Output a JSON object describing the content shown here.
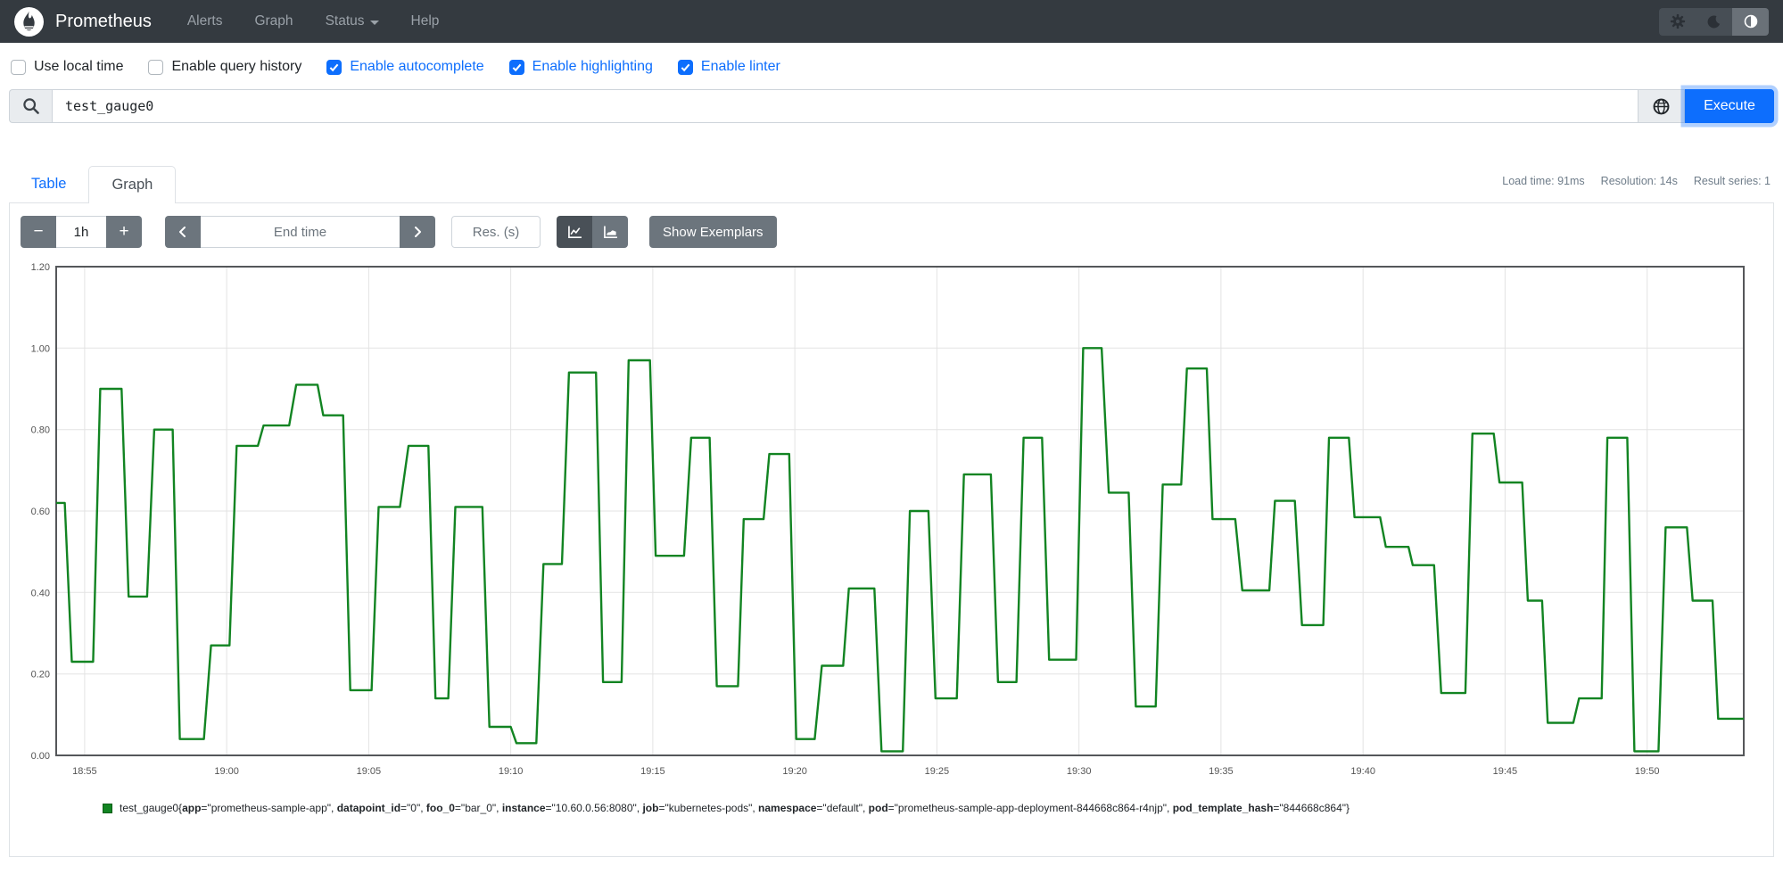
{
  "navbar": {
    "brand": "Prometheus",
    "links": [
      {
        "label": "Alerts"
      },
      {
        "label": "Graph"
      },
      {
        "label": "Status",
        "dropdown": true
      },
      {
        "label": "Help"
      }
    ],
    "theme_buttons": [
      "settings-gear-icon",
      "dark-mode-moon-icon",
      "auto-theme-contrast-icon"
    ],
    "colors": {
      "bar": "#343a40",
      "link": "#9aa1a8",
      "brand": "#ffffff"
    }
  },
  "options": {
    "checkboxes": [
      {
        "label": "Use local time",
        "checked": false
      },
      {
        "label": "Enable query history",
        "checked": false
      },
      {
        "label": "Enable autocomplete",
        "checked": true
      },
      {
        "label": "Enable highlighting",
        "checked": true
      },
      {
        "label": "Enable linter",
        "checked": true
      }
    ],
    "accent": "#0d6efd"
  },
  "query": {
    "value": "test_gauge0",
    "execute_label": "Execute",
    "icons": [
      "search-icon",
      "metrics-explorer-globe-icon"
    ]
  },
  "tabs": {
    "table_label": "Table",
    "graph_label": "Graph",
    "active": "Graph"
  },
  "stats": {
    "load_time": "Load time: 91ms",
    "resolution": "Resolution: 14s",
    "result_series": "Result series: 1"
  },
  "graph_controls": {
    "minus_label": "−",
    "range_value": "1h",
    "plus_label": "+",
    "end_time_placeholder": "End time",
    "res_placeholder": "Res. (s)",
    "show_exemplars_label": "Show Exemplars",
    "chart_type_icons": [
      "line-chart-icon",
      "stacked-chart-icon"
    ],
    "active_chart_type": "line"
  },
  "chart_data": {
    "type": "line",
    "title": "",
    "xlabel": "",
    "ylabel": "",
    "grid": true,
    "ylim": [
      0,
      1.2
    ],
    "y_ticks": [
      "0.00",
      "0.20",
      "0.40",
      "0.60",
      "0.80",
      "1.00",
      "1.20"
    ],
    "x_domain_minutes": [
      0,
      59.4
    ],
    "x_ticks": [
      {
        "minute": 1,
        "label": "18:55"
      },
      {
        "minute": 6,
        "label": "19:00"
      },
      {
        "minute": 11,
        "label": "19:05"
      },
      {
        "minute": 16,
        "label": "19:10"
      },
      {
        "minute": 21,
        "label": "19:15"
      },
      {
        "minute": 26,
        "label": "19:20"
      },
      {
        "minute": 31,
        "label": "19:25"
      },
      {
        "minute": 36,
        "label": "19:30"
      },
      {
        "minute": 41,
        "label": "19:35"
      },
      {
        "minute": 46,
        "label": "19:40"
      },
      {
        "minute": 51,
        "label": "19:45"
      },
      {
        "minute": 56,
        "label": "19:50"
      }
    ],
    "line_color": "#128422",
    "series": [
      {
        "name": "test_gauge0",
        "points": [
          [
            0,
            0.62
          ],
          [
            0.3,
            0.62
          ],
          [
            0.55,
            0.23
          ],
          [
            1.3,
            0.23
          ],
          [
            1.55,
            0.9
          ],
          [
            2.3,
            0.9
          ],
          [
            2.55,
            0.39
          ],
          [
            3.2,
            0.39
          ],
          [
            3.45,
            0.8
          ],
          [
            4.1,
            0.8
          ],
          [
            4.35,
            0.04
          ],
          [
            5.2,
            0.04
          ],
          [
            5.45,
            0.27
          ],
          [
            6.1,
            0.27
          ],
          [
            6.35,
            0.76
          ],
          [
            7.1,
            0.76
          ],
          [
            7.3,
            0.81
          ],
          [
            8.2,
            0.81
          ],
          [
            8.45,
            0.91
          ],
          [
            9.2,
            0.91
          ],
          [
            9.4,
            0.835
          ],
          [
            10.1,
            0.835
          ],
          [
            10.35,
            0.16
          ],
          [
            11.1,
            0.16
          ],
          [
            11.35,
            0.61
          ],
          [
            12.1,
            0.61
          ],
          [
            12.4,
            0.76
          ],
          [
            13.1,
            0.76
          ],
          [
            13.35,
            0.14
          ],
          [
            13.8,
            0.14
          ],
          [
            14.05,
            0.61
          ],
          [
            15,
            0.61
          ],
          [
            15.25,
            0.07
          ],
          [
            16,
            0.07
          ],
          [
            16.2,
            0.03
          ],
          [
            16.9,
            0.03
          ],
          [
            17.15,
            0.47
          ],
          [
            17.8,
            0.47
          ],
          [
            18.05,
            0.94
          ],
          [
            19,
            0.94
          ],
          [
            19.25,
            0.18
          ],
          [
            19.9,
            0.18
          ],
          [
            20.15,
            0.97
          ],
          [
            20.9,
            0.97
          ],
          [
            21.1,
            0.49
          ],
          [
            22.1,
            0.49
          ],
          [
            22.35,
            0.78
          ],
          [
            23,
            0.78
          ],
          [
            23.25,
            0.17
          ],
          [
            24,
            0.17
          ],
          [
            24.2,
            0.58
          ],
          [
            24.9,
            0.58
          ],
          [
            25.1,
            0.74
          ],
          [
            25.8,
            0.74
          ],
          [
            26.05,
            0.04
          ],
          [
            26.7,
            0.04
          ],
          [
            26.95,
            0.22
          ],
          [
            27.7,
            0.22
          ],
          [
            27.9,
            0.41
          ],
          [
            28.8,
            0.41
          ],
          [
            29.05,
            0.01
          ],
          [
            29.8,
            0.01
          ],
          [
            30.05,
            0.6
          ],
          [
            30.7,
            0.6
          ],
          [
            30.95,
            0.14
          ],
          [
            31.7,
            0.14
          ],
          [
            31.95,
            0.69
          ],
          [
            32.9,
            0.69
          ],
          [
            33.15,
            0.18
          ],
          [
            33.8,
            0.18
          ],
          [
            34.05,
            0.78
          ],
          [
            34.7,
            0.78
          ],
          [
            34.95,
            0.235
          ],
          [
            35.9,
            0.235
          ],
          [
            36.15,
            1
          ],
          [
            36.8,
            1
          ],
          [
            37.05,
            0.645
          ],
          [
            37.75,
            0.645
          ],
          [
            38,
            0.12
          ],
          [
            38.7,
            0.12
          ],
          [
            38.95,
            0.665
          ],
          [
            39.6,
            0.665
          ],
          [
            39.8,
            0.95
          ],
          [
            40.5,
            0.95
          ],
          [
            40.7,
            0.58
          ],
          [
            41.5,
            0.58
          ],
          [
            41.75,
            0.405
          ],
          [
            42.7,
            0.405
          ],
          [
            42.9,
            0.625
          ],
          [
            43.6,
            0.625
          ],
          [
            43.85,
            0.32
          ],
          [
            44.6,
            0.32
          ],
          [
            44.8,
            0.78
          ],
          [
            45.5,
            0.78
          ],
          [
            45.7,
            0.585
          ],
          [
            46.6,
            0.585
          ],
          [
            46.8,
            0.512
          ],
          [
            47.6,
            0.512
          ],
          [
            47.75,
            0.467
          ],
          [
            48.5,
            0.467
          ],
          [
            48.75,
            0.153
          ],
          [
            49.6,
            0.153
          ],
          [
            49.85,
            0.79
          ],
          [
            50.6,
            0.79
          ],
          [
            50.8,
            0.67
          ],
          [
            51.6,
            0.67
          ],
          [
            51.8,
            0.38
          ],
          [
            52.3,
            0.38
          ],
          [
            52.5,
            0.08
          ],
          [
            53.4,
            0.08
          ],
          [
            53.6,
            0.14
          ],
          [
            54.4,
            0.14
          ],
          [
            54.6,
            0.78
          ],
          [
            55.3,
            0.78
          ],
          [
            55.55,
            0.01
          ],
          [
            56.4,
            0.01
          ],
          [
            56.65,
            0.56
          ],
          [
            57.4,
            0.56
          ],
          [
            57.6,
            0.38
          ],
          [
            58.3,
            0.38
          ],
          [
            58.5,
            0.09
          ],
          [
            59.4,
            0.09
          ]
        ]
      }
    ]
  },
  "legend": {
    "metric": "test_gauge0",
    "swatch_color": "#128422",
    "swatch_border": "#0b5e17",
    "labels": [
      {
        "key": "app",
        "value": "prometheus-sample-app"
      },
      {
        "key": "datapoint_id",
        "value": "0"
      },
      {
        "key": "foo_0",
        "value": "bar_0"
      },
      {
        "key": "instance",
        "value": "10.60.0.56:8080"
      },
      {
        "key": "job",
        "value": "kubernetes-pods"
      },
      {
        "key": "namespace",
        "value": "default"
      },
      {
        "key": "pod",
        "value": "prometheus-sample-app-deployment-844668c864-r4njp"
      },
      {
        "key": "pod_template_hash",
        "value": "844668c864"
      }
    ]
  }
}
